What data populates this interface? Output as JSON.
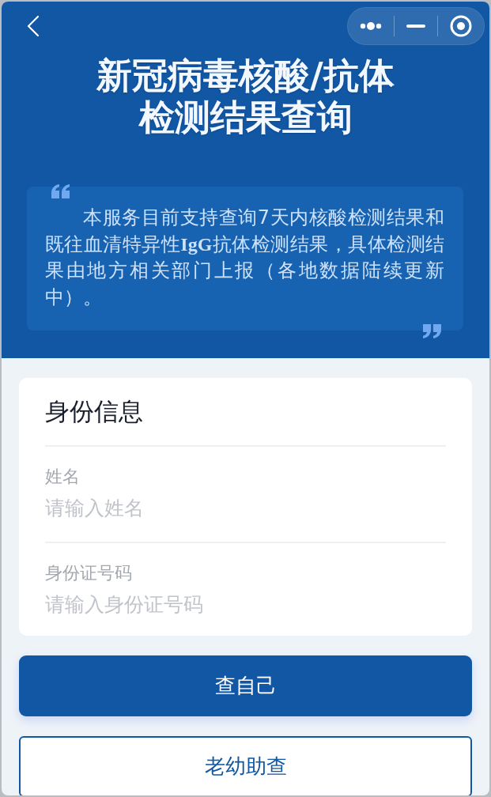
{
  "header": {
    "title_lines": [
      "新冠病毒核酸/抗体",
      "检测结果查询"
    ],
    "notice": "本服务目前支持查询7天内核酸检测结果和既往血清特异性**IgG**抗体检测结果，具体检测结果由地方相关部门上报（各地数据陆续更新中）。"
  },
  "form": {
    "title": "身份信息",
    "fields": [
      {
        "label": "姓名",
        "placeholder": "请输入姓名"
      },
      {
        "label": "身份证号码",
        "placeholder": "请输入身份证号码"
      }
    ]
  },
  "buttons": [
    {
      "label": "查自己",
      "kind": "primary"
    },
    {
      "label": "老幼助查",
      "kind": "outline"
    }
  ]
}
